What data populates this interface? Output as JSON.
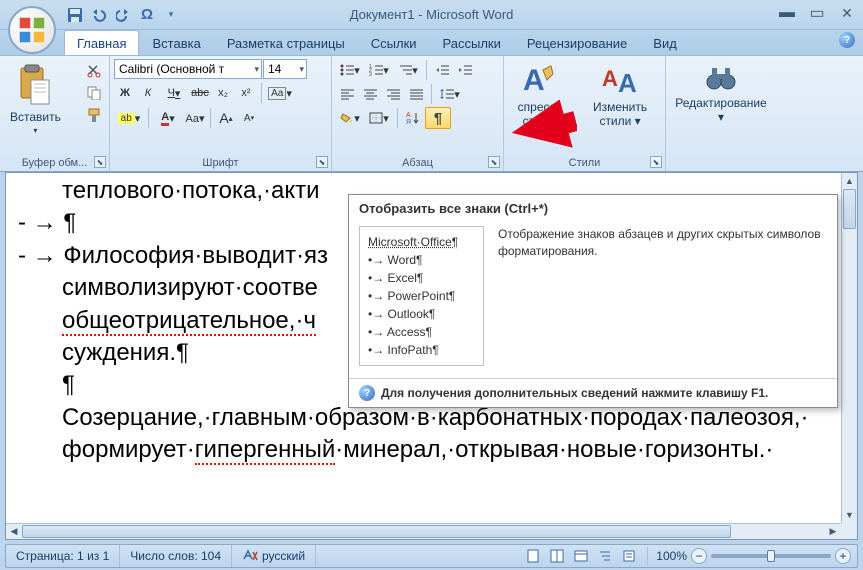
{
  "title": "Документ1 - Microsoft Word",
  "tabs": [
    "Главная",
    "Вставка",
    "Разметка страницы",
    "Ссылки",
    "Рассылки",
    "Рецензирование",
    "Вид"
  ],
  "active_tab": 0,
  "clipboard": {
    "paste": "Вставить",
    "group": "Буфер обм..."
  },
  "font": {
    "group": "Шрифт",
    "name": "Calibri (Основной т",
    "size": "14",
    "bold": "Ж",
    "italic": "К",
    "underline": "Ч",
    "strike": "abc",
    "sub": "x₂",
    "sup": "x²",
    "clear": "Aa",
    "grow": "A",
    "shrink": "A"
  },
  "paragraph": {
    "group": "Абзац"
  },
  "styles": {
    "group": "Стили",
    "quick": "спресс-стили",
    "change": "Изменить стили"
  },
  "editing": {
    "group": "Редактирование"
  },
  "tooltip": {
    "title": "Отобразить все знаки (Ctrl+*)",
    "sample": [
      "Microsoft·Office¶",
      "•→ Word¶",
      "•→ Excel¶",
      "•→ PowerPoint¶",
      "•→ Outlook¶",
      "•→ Access¶",
      "•→ InfoPath¶"
    ],
    "desc": "Отображение знаков абзацев и других скрытых символов форматирования.",
    "footer": "Для получения дополнительных сведений нажмите клавишу F1."
  },
  "doc_lines": [
    "теплового·потока,·акти",
    "- → ¶",
    "- → Философия·выводит·яз",
    "символизируют·соотве",
    "общеотрицательное,·ч",
    "суждения.¶",
    "¶",
    "Созерцание,·главным·образом·в·карбонатных·породах·палеозоя,·",
    "формирует·гипергенный·минерал,·открывая·новые·горизонты.·"
  ],
  "status": {
    "page": "Страница: 1 из 1",
    "words": "Число слов: 104",
    "lang": "русский",
    "zoom": "100%"
  }
}
